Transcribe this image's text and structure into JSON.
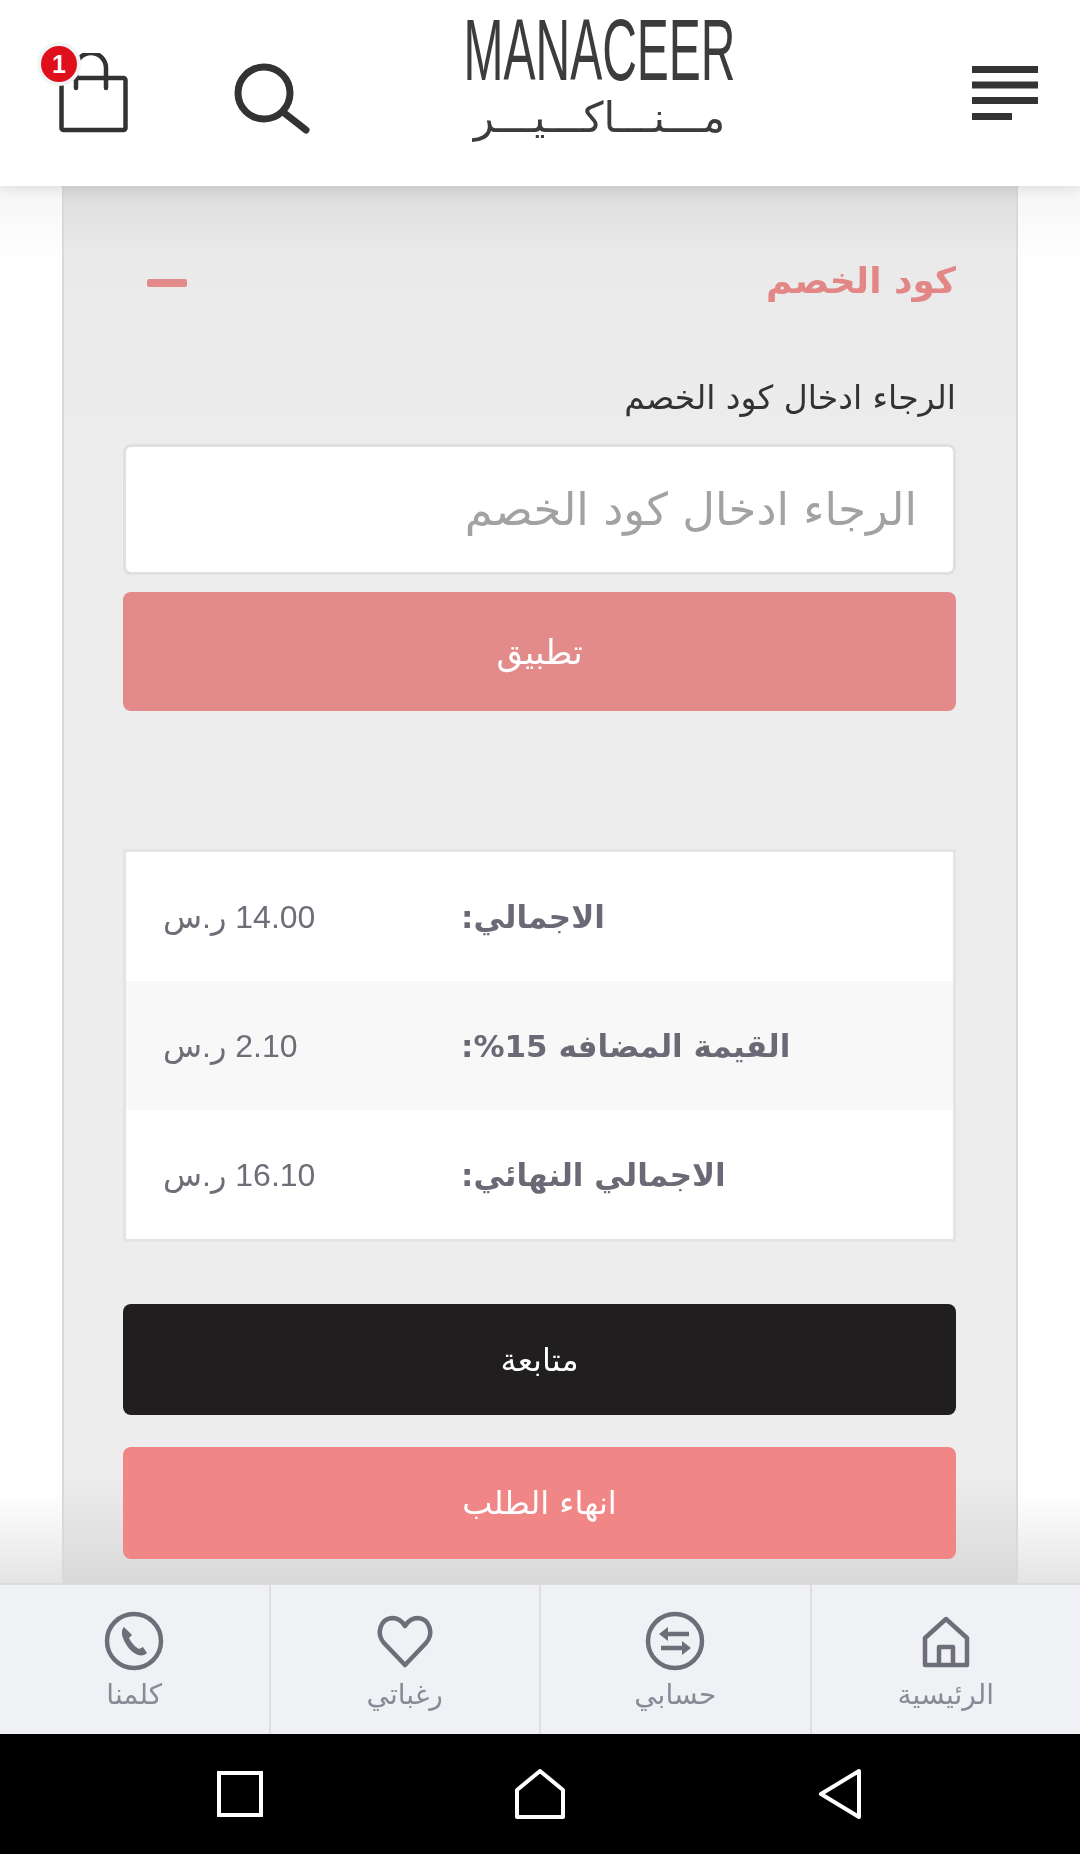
{
  "header": {
    "cart_badge": "1",
    "logo": {
      "latin": "MANACEER",
      "arabic": "مـــنـــاكـــيـــر"
    }
  },
  "discount": {
    "title": "كود الخصم",
    "expanded": true,
    "label": "الرجاء ادخال كود الخصم",
    "placeholder": "الرجاء ادخال كود الخصم",
    "apply_button": "تطبيق"
  },
  "totals": [
    {
      "label": "الاجمالي:",
      "value": "14.00 ر.س"
    },
    {
      "label": "القيمة المضافه 15%:",
      "value": "2.10 ر.س"
    },
    {
      "label": "الاجمالي النهائي:",
      "value": "16.10 ر.س"
    }
  ],
  "actions": [
    {
      "kind": "dark",
      "label": "متابعة"
    },
    {
      "kind": "accent",
      "label": "انهاء الطلب"
    }
  ],
  "bottom_nav": [
    {
      "label": "الرئيسية"
    },
    {
      "label": "حسابي"
    },
    {
      "label": "رغباتي"
    },
    {
      "label": "كلمنا"
    }
  ]
}
